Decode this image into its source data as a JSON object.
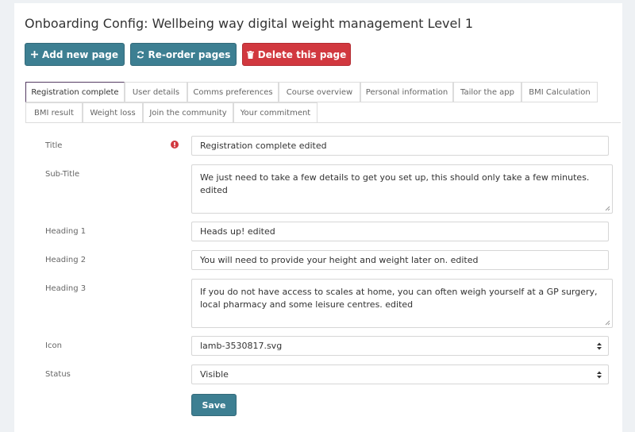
{
  "page": {
    "title": "Onboarding Config: Wellbeing way digital weight management Level 1"
  },
  "toolbar": {
    "add_label": "Add new page",
    "reorder_label": "Re-order pages",
    "delete_label": "Delete this page",
    "add_icon": "plus-icon",
    "reorder_icon": "refresh-icon",
    "delete_icon": "trash-icon"
  },
  "tabs": [
    {
      "label": "Registration complete",
      "active": true
    },
    {
      "label": "User details",
      "active": false
    },
    {
      "label": "Comms preferences",
      "active": false
    },
    {
      "label": "Course overview",
      "active": false
    },
    {
      "label": "Personal information",
      "active": false
    },
    {
      "label": "Tailor the app",
      "active": false
    },
    {
      "label": "BMI Calculation",
      "active": false
    },
    {
      "label": "BMI result",
      "active": false
    },
    {
      "label": "Weight loss",
      "active": false
    },
    {
      "label": "Join the community",
      "active": false
    },
    {
      "label": "Your commitment",
      "active": false
    }
  ],
  "form": {
    "title_label": "Title",
    "title_value": "Registration complete edited",
    "subtitle_label": "Sub-Title",
    "subtitle_value": "We just need to take a few details to get you set up, this should only take a few minutes. edited",
    "heading1_label": "Heading 1",
    "heading1_value": "Heads up! edited",
    "heading2_label": "Heading 2",
    "heading2_value": "You will need to provide your height and weight later on. edited",
    "heading3_label": "Heading 3",
    "heading3_value": "If you do not have access to scales at home, you can often weigh yourself at a GP surgery, local pharmacy and some leisure centres. edited",
    "icon_label": "Icon",
    "icon_value": "lamb-3530817.svg",
    "status_label": "Status",
    "status_value": "Visible",
    "save_label": "Save"
  },
  "colors": {
    "primary": "#3d7f92",
    "danger": "#d1383f",
    "required": "#d1383f",
    "active_tab_border": "#553c63"
  }
}
